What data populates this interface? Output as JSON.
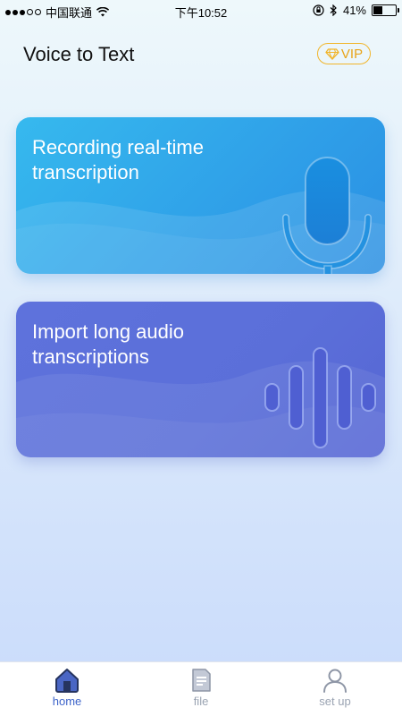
{
  "status_bar": {
    "carrier": "中国联通",
    "time": "下午10:52",
    "battery_percent": "41%",
    "battery_level": 0.41,
    "icons": [
      "signal-dots-icon",
      "wifi-icon",
      "orientation-lock-icon",
      "bluetooth-icon",
      "battery-icon"
    ]
  },
  "header": {
    "title": "Voice to Text",
    "vip_label": "VIP",
    "vip_icon": "diamond-icon"
  },
  "cards": [
    {
      "title": "Recording real-time transcription",
      "icon": "microphone-icon",
      "color": "#2f9fe8"
    },
    {
      "title": "Import long audio transcriptions",
      "icon": "sound-wave-icon",
      "color": "#5b6fd9"
    }
  ],
  "tabs": [
    {
      "label": "home",
      "icon": "home-icon",
      "active": true
    },
    {
      "label": "file",
      "icon": "file-icon",
      "active": false
    },
    {
      "label": "set up",
      "icon": "user-icon",
      "active": false
    }
  ],
  "colors": {
    "accent": "#3c63c9",
    "vip": "#f1b52a",
    "inactive": "#9aa3b2"
  }
}
